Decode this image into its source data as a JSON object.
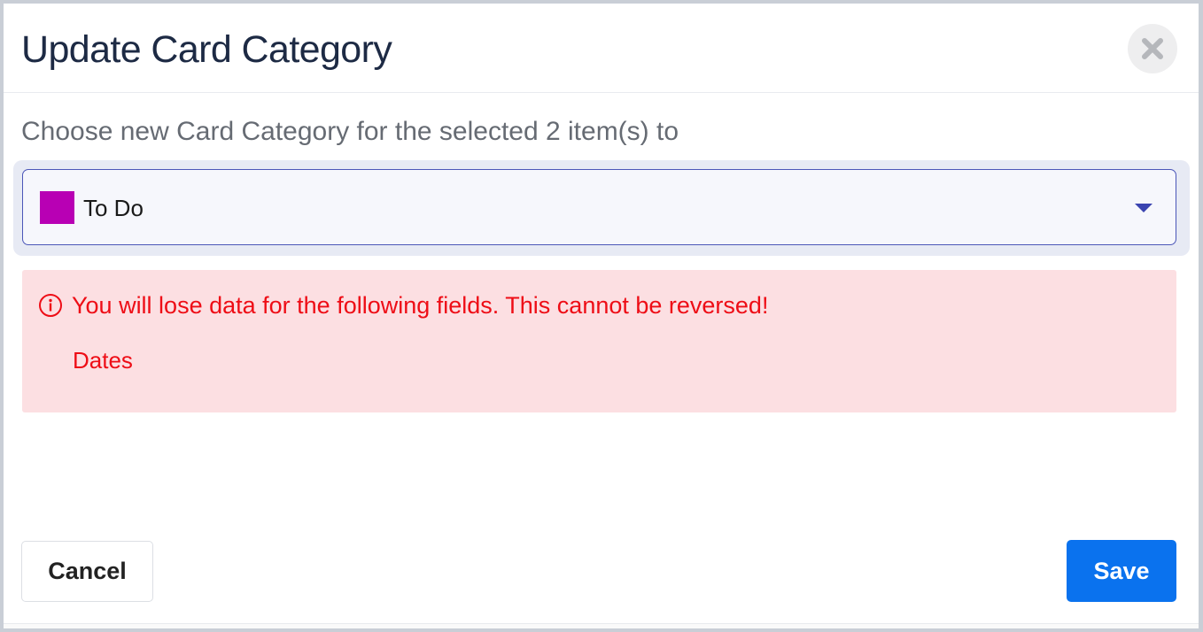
{
  "dialog": {
    "title": "Update Card Category",
    "prompt": "Choose new Card Category for the selected 2 item(s) to",
    "close_icon": "close-x-icon"
  },
  "category_select": {
    "value": "To Do",
    "swatch_color": "#b800b4",
    "caret_icon": "caret-down-icon"
  },
  "warning": {
    "icon": "info-circle-icon",
    "message": "You will lose data for the following fields. This cannot be reversed!",
    "fields": [
      "Dates"
    ],
    "color": "#ee0d16",
    "background": "#fcdfe2"
  },
  "footer": {
    "cancel_label": "Cancel",
    "save_label": "Save",
    "save_color": "#0a72ee"
  }
}
